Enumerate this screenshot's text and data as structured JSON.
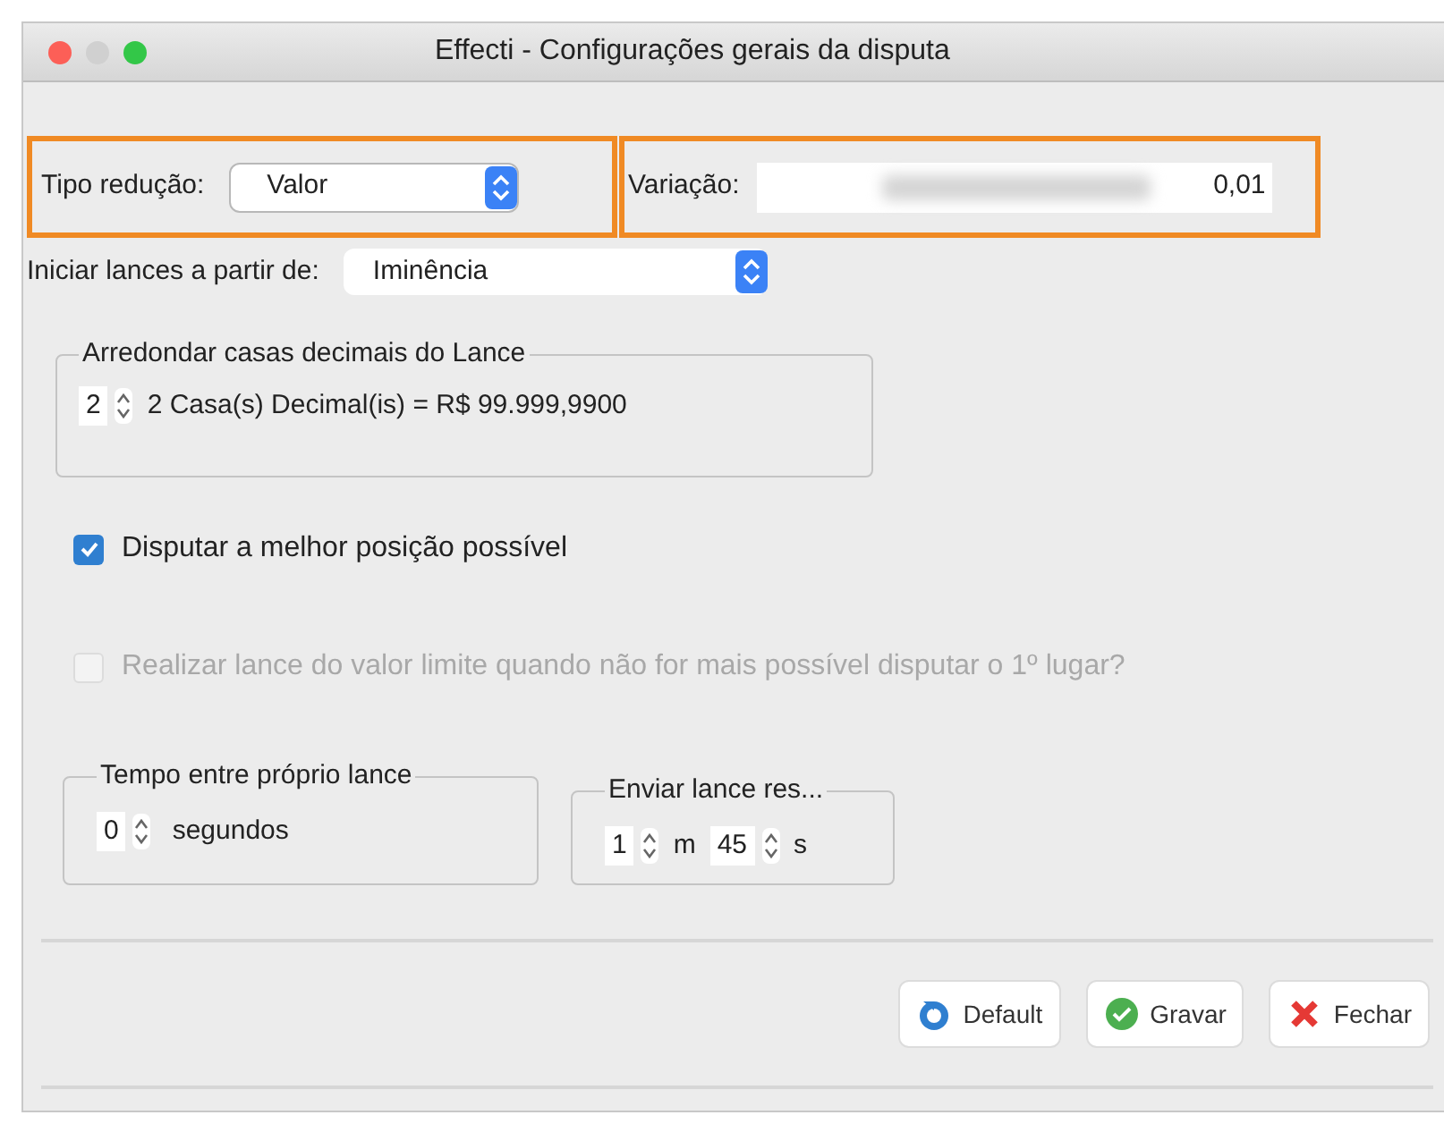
{
  "window": {
    "title": "Effecti - Configurações gerais da disputa"
  },
  "reduction": {
    "label": "Tipo redução:",
    "value": "Valor",
    "highlighted": true
  },
  "variation": {
    "label": "Variação:",
    "value": "0,01",
    "highlighted": true
  },
  "start_bids": {
    "label": "Iniciar lances a partir de:",
    "value": "Iminência"
  },
  "rounding": {
    "title": "Arredondar casas decimais do Lance",
    "value": "2",
    "description": "2 Casa(s) Decimal(is) = R$ 99.999,9900"
  },
  "options": [
    {
      "label": "Disputar a melhor posição possível",
      "checked": true,
      "disabled": false
    },
    {
      "label": "Realizar lance do valor limite quando não for mais possível disputar o 1º lugar?",
      "checked": false,
      "disabled": true
    }
  ],
  "own_bid_time": {
    "title": "Tempo entre próprio lance",
    "value": "0",
    "unit": "segundos"
  },
  "send_bid": {
    "title": "Enviar lance res...",
    "minutes": "1",
    "minutes_unit": "m",
    "seconds": "45",
    "seconds_unit": "s"
  },
  "buttons": [
    {
      "label": "Default",
      "kind": "default"
    },
    {
      "label": "Gravar",
      "kind": "save"
    },
    {
      "label": "Fechar",
      "kind": "close"
    }
  ]
}
